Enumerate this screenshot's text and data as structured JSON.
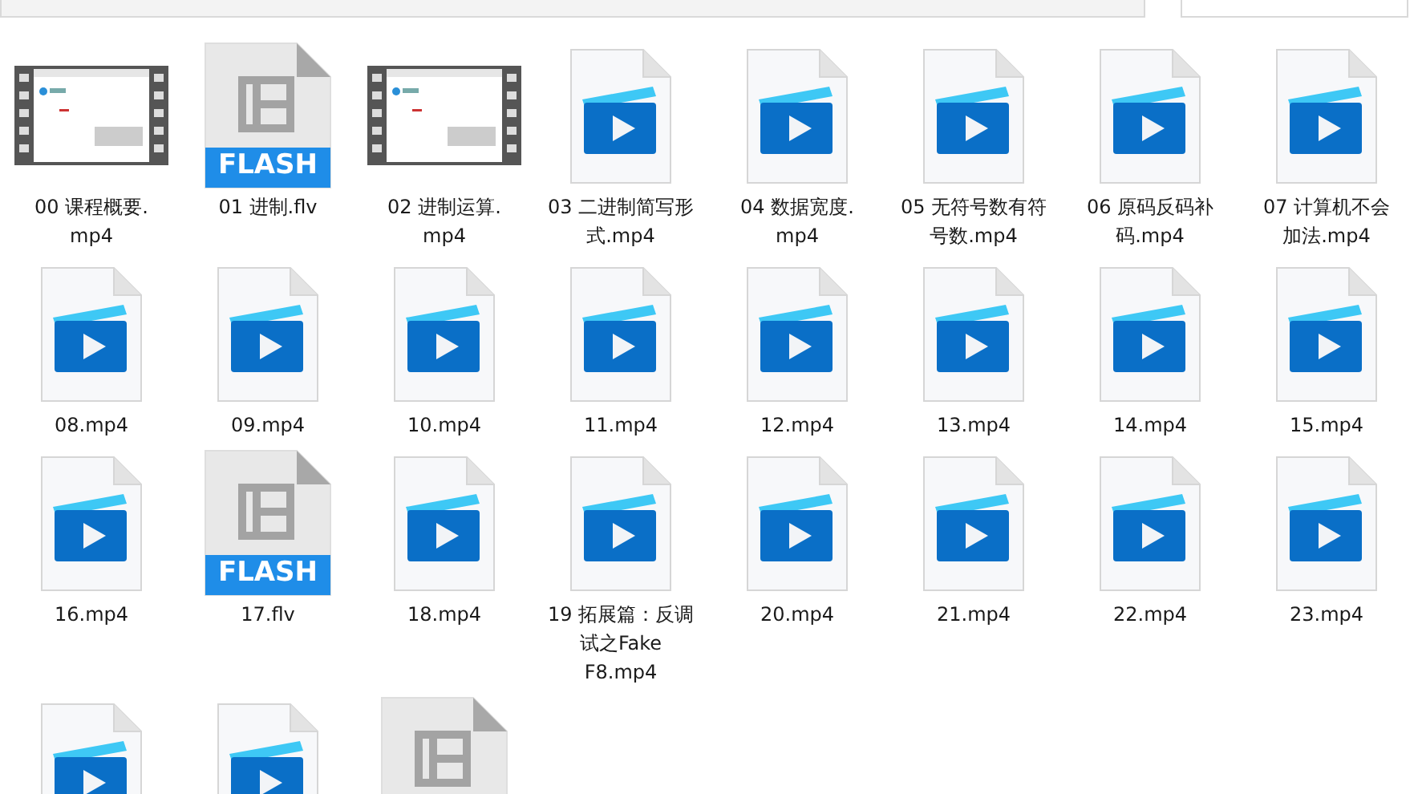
{
  "files": [
    {
      "kind": "thumbnail",
      "label_lines": [
        "00 课程概要.",
        "mp4"
      ]
    },
    {
      "kind": "flash",
      "badge": "FLASH",
      "label_lines": [
        "01 进制.flv"
      ]
    },
    {
      "kind": "thumbnail",
      "label_lines": [
        "02 进制运算.",
        "mp4"
      ]
    },
    {
      "kind": "video",
      "label_lines": [
        "03 二进制简写形",
        "式.mp4"
      ]
    },
    {
      "kind": "video",
      "label_lines": [
        "04 数据宽度.",
        "mp4"
      ]
    },
    {
      "kind": "video",
      "label_lines": [
        "05 无符号数有符",
        "号数.mp4"
      ]
    },
    {
      "kind": "video",
      "label_lines": [
        "06 原码反码补",
        "码.mp4"
      ]
    },
    {
      "kind": "video",
      "label_lines": [
        "07 计算机不会",
        "加法.mp4"
      ]
    },
    {
      "kind": "video",
      "label_lines": [
        "08.mp4"
      ]
    },
    {
      "kind": "video",
      "label_lines": [
        "09.mp4"
      ]
    },
    {
      "kind": "video",
      "label_lines": [
        "10.mp4"
      ]
    },
    {
      "kind": "video",
      "label_lines": [
        "11.mp4"
      ]
    },
    {
      "kind": "video",
      "label_lines": [
        "12.mp4"
      ]
    },
    {
      "kind": "video",
      "label_lines": [
        "13.mp4"
      ]
    },
    {
      "kind": "video",
      "label_lines": [
        "14.mp4"
      ]
    },
    {
      "kind": "video",
      "label_lines": [
        "15.mp4"
      ]
    },
    {
      "kind": "video",
      "label_lines": [
        "16.mp4"
      ]
    },
    {
      "kind": "flash",
      "badge": "FLASH",
      "label_lines": [
        "17.flv"
      ]
    },
    {
      "kind": "video",
      "label_lines": [
        "18.mp4"
      ]
    },
    {
      "kind": "video",
      "label_lines": [
        "19 拓展篇：反调",
        "试之Fake",
        "F8.mp4"
      ]
    },
    {
      "kind": "video",
      "label_lines": [
        "20.mp4"
      ]
    },
    {
      "kind": "video",
      "label_lines": [
        "21.mp4"
      ]
    },
    {
      "kind": "video",
      "label_lines": [
        "22.mp4"
      ]
    },
    {
      "kind": "video",
      "label_lines": [
        "23.mp4"
      ]
    },
    {
      "kind": "video"
    },
    {
      "kind": "video"
    },
    {
      "kind": "generic"
    }
  ]
}
